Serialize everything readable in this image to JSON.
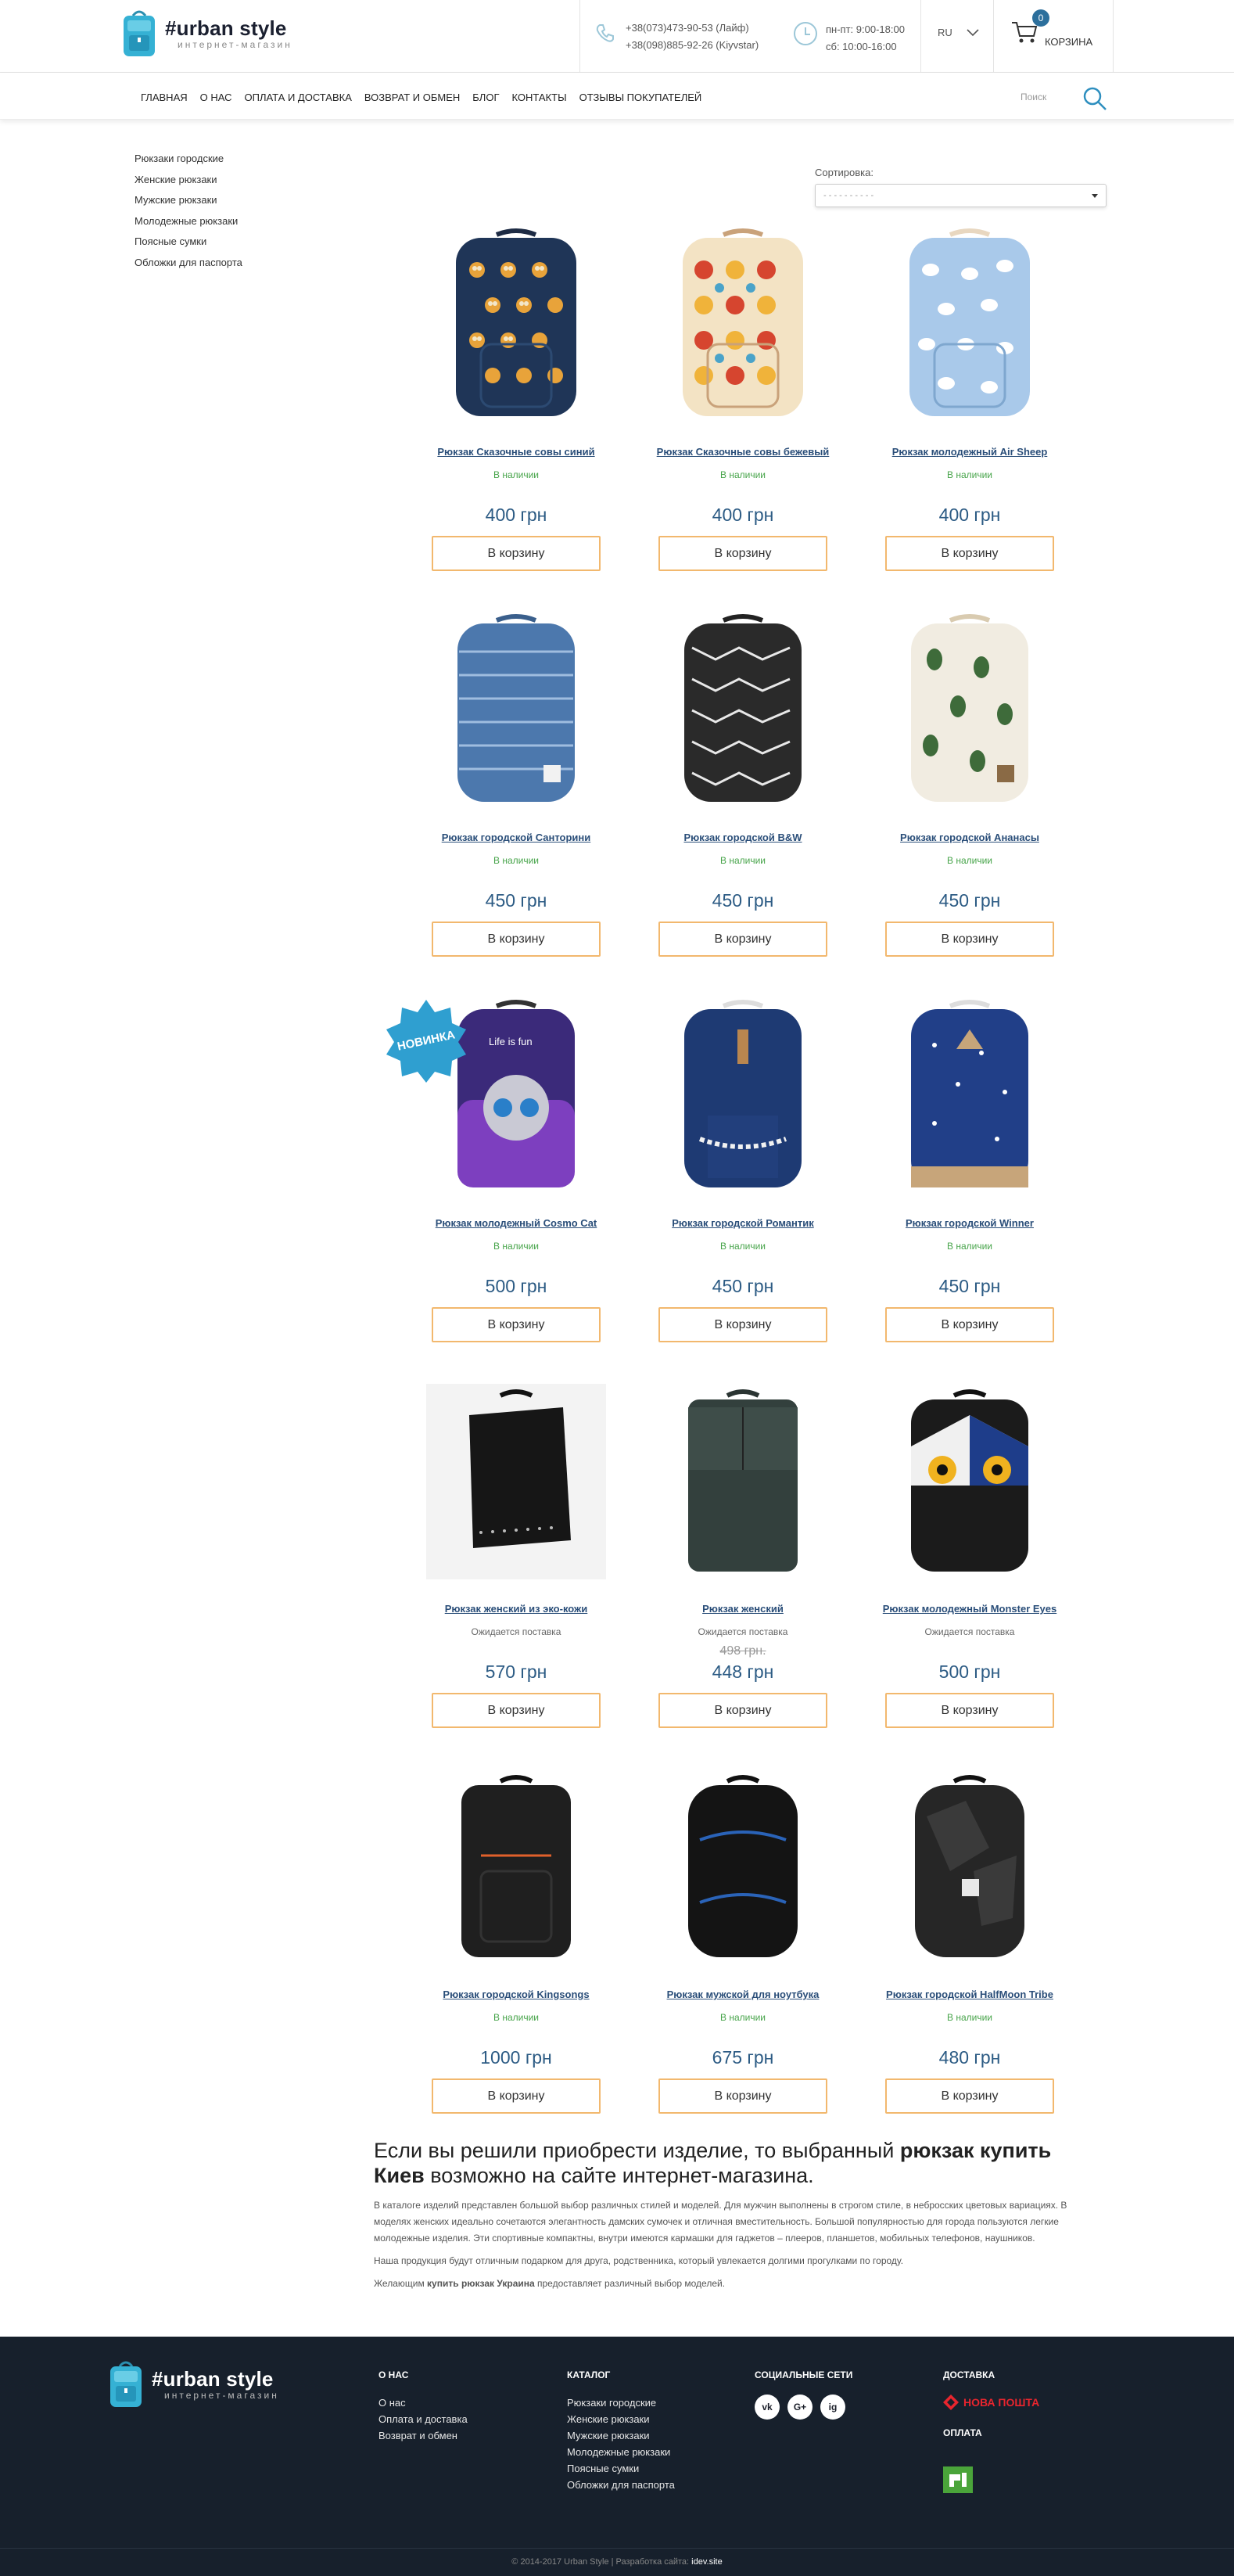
{
  "header": {
    "logo_title": "#urban style",
    "logo_sub": "интернет-магазин",
    "phone1": "+38(073)473-90-53 (Лайф)",
    "phone2": "+38(098)885-92-26 (Kiyvstar)",
    "hours1": "пн-пт: 9:00-18:00",
    "hours2": "сб: 10:00-16:00",
    "lang": "RU",
    "cart_count": "0",
    "cart_label": "КОРЗИНА"
  },
  "nav": {
    "items": [
      "Главная",
      "О нас",
      "Оплата и доставка",
      "Возврат и обмен",
      "Блог",
      "Контакты",
      "Отзывы покупателей"
    ],
    "search_placeholder": "Поиск"
  },
  "sidebar": {
    "items": [
      "Рюкзаки городские",
      "Женские рюкзаки",
      "Мужские рюкзаки",
      "Молодежные рюкзаки",
      "Поясные сумки",
      "Обложки для паспорта"
    ]
  },
  "sort": {
    "label": "Сортировка:",
    "selected": "- - - - - - - - - -"
  },
  "products": [
    {
      "name": "Рюкзак Сказочные совы синий",
      "stock": "В наличии",
      "price": "400 грн",
      "button": "В корзину"
    },
    {
      "name": "Рюкзак Сказочные совы бежевый",
      "stock": "В наличии",
      "price": "400 грн",
      "button": "В корзину"
    },
    {
      "name": "Рюкзак молодежный Air Sheep",
      "stock": "В наличии",
      "price": "400 грн",
      "button": "В корзину"
    },
    {
      "name": "Рюкзак городской Санторини",
      "stock": "В наличии",
      "price": "450 грн",
      "button": "В корзину"
    },
    {
      "name": "Рюкзак городской B&W",
      "stock": "В наличии",
      "price": "450 грн",
      "button": "В корзину"
    },
    {
      "name": "Рюкзак городской Ананасы",
      "stock": "В наличии",
      "price": "450 грн",
      "button": "В корзину"
    },
    {
      "name": "Рюкзак молодежный Cosmo Cat",
      "stock": "В наличии",
      "price": "500 грн",
      "button": "В корзину",
      "badge": "НОВИНКА",
      "print": "Life is fun"
    },
    {
      "name": "Рюкзак городской Романтик",
      "stock": "В наличии",
      "price": "450 грн",
      "button": "В корзину"
    },
    {
      "name": "Рюкзак городской Winner",
      "stock": "В наличии",
      "price": "450 грн",
      "button": "В корзину"
    },
    {
      "name": "Рюкзак женский из эко-кожи",
      "stock": "Ожидается поставка",
      "price": "570 грн",
      "button": "В корзину"
    },
    {
      "name": "Рюкзак женский",
      "stock": "Ожидается поставка",
      "old_price": "498 грн.",
      "price": "448 грн",
      "button": "В корзину"
    },
    {
      "name": "Рюкзак молодежный Monster Eyes",
      "stock": "Ожидается поставка",
      "price": "500 грн",
      "button": "В корзину"
    },
    {
      "name": "Рюкзак городской Kingsongs",
      "stock": "В наличии",
      "price": "1000 грн",
      "button": "В корзину"
    },
    {
      "name": "Рюкзак мужской для ноутбука",
      "stock": "В наличии",
      "price": "675 грн",
      "button": "В корзину"
    },
    {
      "name": "Рюкзак городской HalfMoon Tribe",
      "stock": "В наличии",
      "price": "480 грн",
      "button": "В корзину"
    }
  ],
  "seo": {
    "heading_a": "Если вы решили приобрести изделие, то выбранный ",
    "heading_b": "рюкзак купить Киев",
    "heading_c": " возможно на сайте интернет-магазина.",
    "p1": "В каталоге изделий представлен большой выбор различных стилей и моделей. Для мужчин выполнены в строгом стиле, в небросских цветовых вариациях. В моделях женских идеально сочетаются элегантность дамских сумочек и отличная вместительность. Большой популярностью для города пользуются легкие молодежные изделия. Эти спортивные компактны, внутри имеются кармашки для гаджетов – плееров, планшетов, мобильных телефонов, наушников.",
    "p2": "Наша продукция будут отличным подарком для друга, родственника, который увлекается долгими прогулками по городу.",
    "p3a": "Желающим ",
    "p3b": "купить рюкзак Украина",
    "p3c": " предоставляет различный выбор моделей."
  },
  "footer": {
    "logo_title": "#urban style",
    "logo_sub": "интернет-магазин",
    "about_head": "О нас",
    "about_links": [
      "О нас",
      "Оплата и доставка",
      "Возврат и обмен"
    ],
    "catalog_head": "Каталог",
    "catalog_links": [
      "Рюкзаки городские",
      "Женские рюкзаки",
      "Мужские рюкзаки",
      "Молодежные рюкзаки",
      "Поясные сумки",
      "Обложки для паспорта"
    ],
    "social_head": "Социальные сети",
    "social": [
      "vk",
      "G+",
      "ig"
    ],
    "delivery_head": "Доставка",
    "delivery_name": "НОВА ПОШТА",
    "payment_head": "Оплата",
    "copyright_a": "© 2014-2017 Urban Style | Разработка сайта: ",
    "copyright_b": "idev.site"
  }
}
